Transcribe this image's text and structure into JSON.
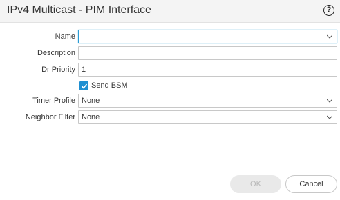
{
  "dialog": {
    "title": "IPv4 Multicast - PIM Interface",
    "help_icon": "help-circle-icon"
  },
  "form": {
    "name": {
      "label": "Name",
      "value": ""
    },
    "description": {
      "label": "Description",
      "value": ""
    },
    "dr_priority": {
      "label": "Dr Priority",
      "value": "1"
    },
    "send_bsm": {
      "label": "Send BSM",
      "checked": true
    },
    "timer_profile": {
      "label": "Timer Profile",
      "value": "None"
    },
    "neighbor_filter": {
      "label": "Neighbor Filter",
      "value": "None"
    }
  },
  "buttons": {
    "ok_label": "OK",
    "cancel_label": "Cancel"
  },
  "colors": {
    "accent": "#1f8fd1",
    "focus_border": "#2a9bd5",
    "disabled_text": "#b8b8b8"
  }
}
